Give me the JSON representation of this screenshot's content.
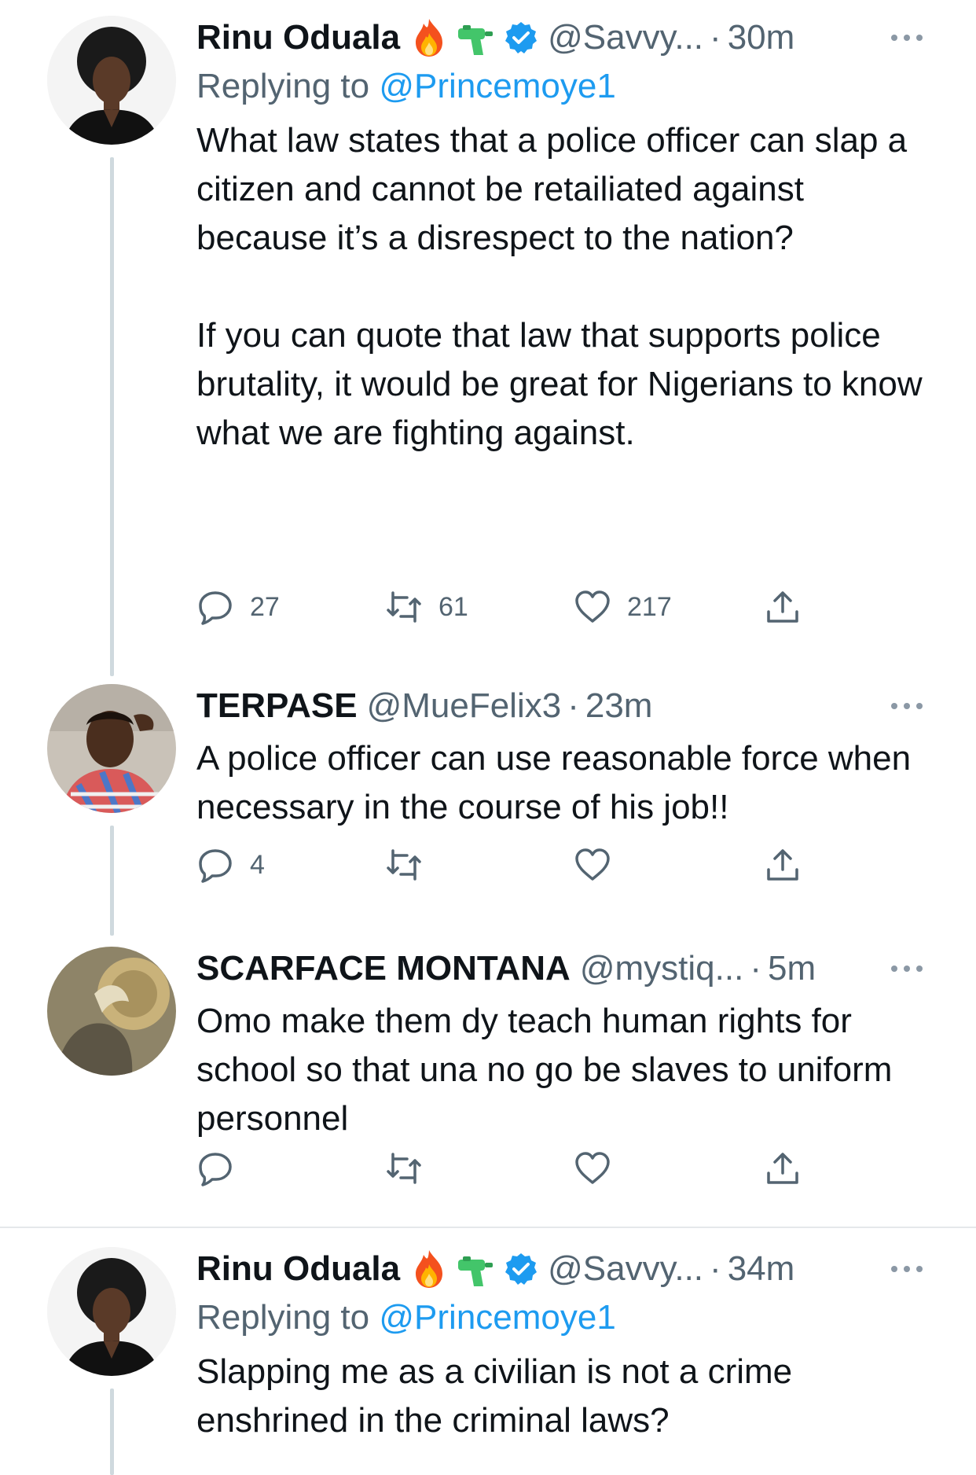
{
  "colors": {
    "text": "#0f1419",
    "secondary": "#536471",
    "link": "#1d9bf0",
    "verified": "#1d9bf0",
    "thread_line": "#cfd9de"
  },
  "tweets": [
    {
      "name": "Rinu Oduala",
      "emojis": [
        "fire-emoji",
        "water-gun-emoji"
      ],
      "verified": true,
      "handle": "@Savvy...",
      "dot": "·",
      "time": "30m",
      "reply_label": "Replying to",
      "reply_mention": "@Princemoye1",
      "paragraphs": [
        "What law states that a police officer can slap a citizen and cannot be retailiated against because it’s a disrespect to the nation?",
        "If you can quote that law that supports police brutality, it would be great for Nigerians to know what we are fighting against."
      ],
      "replies": "27",
      "retweets": "61",
      "likes": "217"
    },
    {
      "name": "TERPASE",
      "handle": "@MueFelix3",
      "dot": "·",
      "time": "23m",
      "paragraphs": [
        "A police officer can use reasonable force when necessary in the course of his job!!"
      ],
      "replies": "4",
      "retweets": "",
      "likes": ""
    },
    {
      "name": "SCARFACE MONTANA",
      "handle": "@mystiq...",
      "dot": "·",
      "time": "5m",
      "paragraphs": [
        "Omo make them dy teach human rights for school so that una no go be slaves to uniform personnel"
      ],
      "replies": "",
      "retweets": "",
      "likes": ""
    },
    {
      "name": "Rinu Oduala",
      "emojis": [
        "fire-emoji",
        "water-gun-emoji"
      ],
      "verified": true,
      "handle": "@Savvy...",
      "dot": "·",
      "time": "34m",
      "reply_label": "Replying to",
      "reply_mention": "@Princemoye1",
      "paragraphs": [
        "Slapping me as a civilian is not a crime enshrined in the criminal laws?"
      ]
    }
  ]
}
